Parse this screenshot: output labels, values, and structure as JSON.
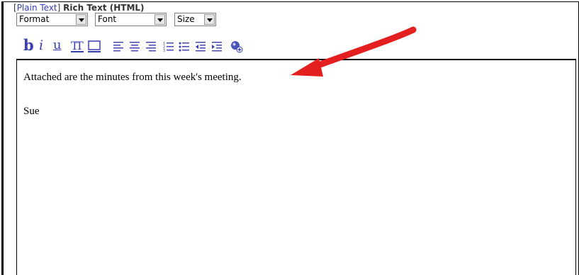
{
  "mode_bar": {
    "open_bracket": "[",
    "plain_text_link": "Plain Text",
    "close_bracket": "]",
    "rich_text_label": "Rich Text (HTML)"
  },
  "selects": {
    "format": "Format",
    "font": "Font",
    "size": "Size"
  },
  "toolbar": {
    "bold_glyph": "b",
    "italic_glyph": "i",
    "underline_glyph": "u",
    "icons": [
      "bold-icon",
      "italic-icon",
      "underline-icon",
      "text-color-icon",
      "highlight-icon",
      "align-left-icon",
      "align-center-icon",
      "align-right-icon",
      "numbered-list-icon",
      "bulleted-list-icon",
      "outdent-icon",
      "indent-icon",
      "insert-link-icon"
    ]
  },
  "editor": {
    "line1": "Attached are the minutes from this week's meeting.",
    "line2": "Sue"
  },
  "colors": {
    "toolbar_icon": "#3a3fb0",
    "link": "#3a40b0",
    "annotation_arrow": "#e41f1f"
  }
}
